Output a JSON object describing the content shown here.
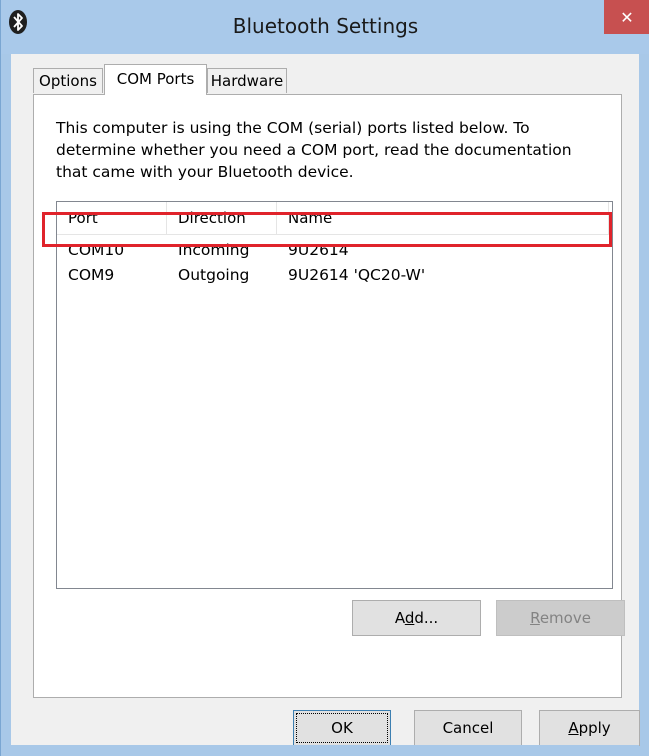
{
  "window": {
    "title": "Bluetooth Settings",
    "close_glyph": "✕"
  },
  "tabs": [
    {
      "label": "Options",
      "active": false
    },
    {
      "label": "COM Ports",
      "active": true
    },
    {
      "label": "Hardware",
      "active": false
    }
  ],
  "com_ports": {
    "description": "This computer is using the COM (serial) ports listed below. To determine whether you need a COM port, read the documentation that came with your Bluetooth device.",
    "columns": [
      "Port",
      "Direction",
      "Name"
    ],
    "rows": [
      {
        "port": "COM10",
        "direction": "Incoming",
        "name": "9U2614"
      },
      {
        "port": "COM9",
        "direction": "Outgoing",
        "name": "9U2614 'QC20-W'"
      }
    ],
    "highlighted_row_index": 1,
    "highlight_color": "#e0232b",
    "add_button": {
      "prefix": "A",
      "accel": "d",
      "suffix": "d...",
      "enabled": true
    },
    "remove_button": {
      "accel": "R",
      "suffix": "emove",
      "enabled": false
    }
  },
  "dialog_buttons": {
    "ok": "OK",
    "cancel": "Cancel",
    "apply_accel": "A",
    "apply_suffix": "pply"
  },
  "icons": {
    "app": "bluetooth-icon",
    "close": "close-icon"
  },
  "colors": {
    "titlebar": "#a9c9ea",
    "close_button": "#c75050"
  }
}
